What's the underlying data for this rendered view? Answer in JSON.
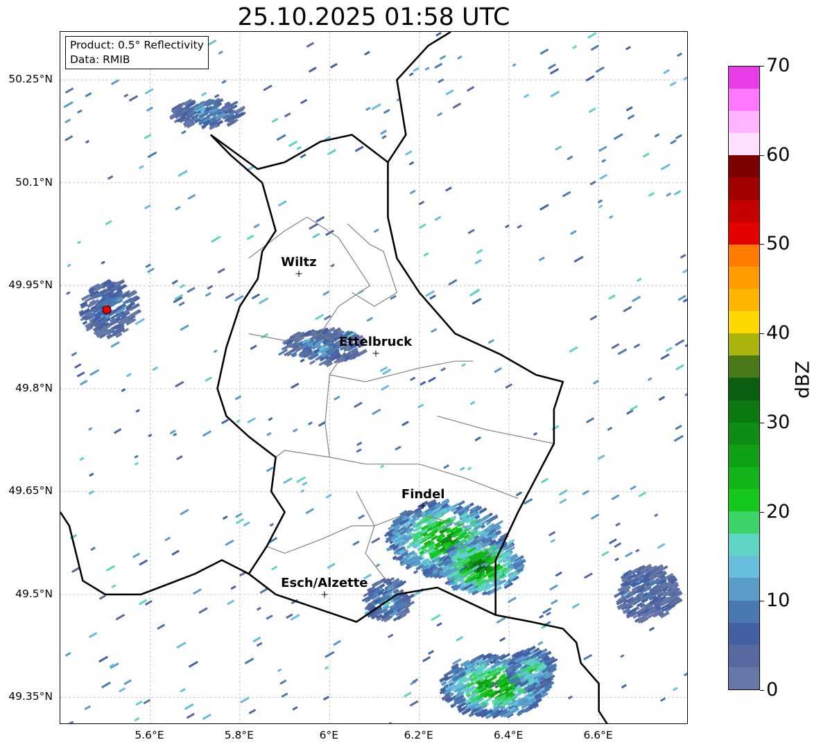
{
  "title": "25.10.2025 01:58 UTC",
  "info": {
    "product": "Product: 0.5° Reflectivity",
    "data": "Data: RMIB"
  },
  "extent": {
    "lon": [
      5.4,
      6.8
    ],
    "lat": [
      49.31,
      50.32
    ]
  },
  "lat_ticks": [
    {
      "value": 50.25,
      "label": "50.25°N"
    },
    {
      "value": 50.1,
      "label": "50.1°N"
    },
    {
      "value": 49.95,
      "label": "49.95°N"
    },
    {
      "value": 49.8,
      "label": "49.8°N"
    },
    {
      "value": 49.65,
      "label": "49.65°N"
    },
    {
      "value": 49.5,
      "label": "49.5°N"
    },
    {
      "value": 49.35,
      "label": "49.35°N"
    }
  ],
  "lon_ticks": [
    {
      "value": 5.6,
      "label": "5.6°E"
    },
    {
      "value": 5.8,
      "label": "5.8°E"
    },
    {
      "value": 6.0,
      "label": "6°E"
    },
    {
      "value": 6.2,
      "label": "6.2°E"
    },
    {
      "value": 6.4,
      "label": "6.4°E"
    },
    {
      "value": 6.6,
      "label": "6.6°E"
    }
  ],
  "cities": [
    {
      "name": "Wiltz",
      "lon": 5.933,
      "lat": 49.967
    },
    {
      "name": "Ettelbruck",
      "lon": 6.104,
      "lat": 49.85
    },
    {
      "name": "Findel",
      "lon": 6.21,
      "lat": 49.628
    },
    {
      "name": "Esch/Alzette",
      "lon": 5.99,
      "lat": 49.499
    }
  ],
  "radar_site": {
    "lon": 5.505,
    "lat": 49.914
  },
  "colorbar": {
    "label": "dBZ",
    "min": 0,
    "max": 70,
    "ticks": [
      {
        "value": 0,
        "label": "0"
      },
      {
        "value": 10,
        "label": "10"
      },
      {
        "value": 20,
        "label": "20"
      },
      {
        "value": 30,
        "label": "30"
      },
      {
        "value": 40,
        "label": "40"
      },
      {
        "value": 50,
        "label": "50"
      },
      {
        "value": 60,
        "label": "60"
      },
      {
        "value": 70,
        "label": "70"
      }
    ],
    "colors": [
      "#6678a8",
      "#5868a0",
      "#4460a4",
      "#4a78b0",
      "#5a9cc8",
      "#66bedc",
      "#5ed4c4",
      "#3cd468",
      "#14c81c",
      "#12b41a",
      "#10a016",
      "#0e8c14",
      "#0c7812",
      "#0a6010",
      "#4a7a18",
      "#aab40c",
      "#ffd800",
      "#ffb400",
      "#ff9c00",
      "#ff7c00",
      "#e40000",
      "#c40000",
      "#a00000",
      "#7c0000",
      "#ffe0ff",
      "#ffb4ff",
      "#ff78ff",
      "#e83ce8"
    ]
  },
  "borders": {
    "luxembourg": [
      [
        5.735,
        50.17
      ],
      [
        5.78,
        50.14
      ],
      [
        5.85,
        50.1
      ],
      [
        5.88,
        50.03
      ],
      [
        5.85,
        50.0
      ],
      [
        5.84,
        49.96
      ],
      [
        5.8,
        49.92
      ],
      [
        5.77,
        49.86
      ],
      [
        5.75,
        49.8
      ],
      [
        5.77,
        49.76
      ],
      [
        5.82,
        49.73
      ],
      [
        5.88,
        49.7
      ],
      [
        5.87,
        49.65
      ],
      [
        5.9,
        49.62
      ],
      [
        5.86,
        49.57
      ],
      [
        5.82,
        49.53
      ],
      [
        5.88,
        49.5
      ],
      [
        5.97,
        49.48
      ],
      [
        6.06,
        49.46
      ],
      [
        6.15,
        49.5
      ],
      [
        6.24,
        49.51
      ],
      [
        6.37,
        49.47
      ],
      [
        6.37,
        49.55
      ],
      [
        6.42,
        49.62
      ],
      [
        6.5,
        49.72
      ],
      [
        6.5,
        49.77
      ],
      [
        6.52,
        49.81
      ],
      [
        6.46,
        49.82
      ],
      [
        6.38,
        49.85
      ],
      [
        6.28,
        49.88
      ],
      [
        6.2,
        49.94
      ],
      [
        6.15,
        49.99
      ],
      [
        6.13,
        50.05
      ],
      [
        6.13,
        50.13
      ],
      [
        6.05,
        50.17
      ],
      [
        5.98,
        50.16
      ],
      [
        5.9,
        50.13
      ],
      [
        5.84,
        50.12
      ],
      [
        5.735,
        50.17
      ]
    ],
    "belgium_france": [
      [
        5.4,
        49.62
      ],
      [
        5.42,
        49.6
      ],
      [
        5.45,
        49.52
      ],
      [
        5.5,
        49.5
      ],
      [
        5.58,
        49.5
      ],
      [
        5.62,
        49.51
      ],
      [
        5.7,
        49.53
      ],
      [
        5.76,
        49.55
      ],
      [
        5.82,
        49.53
      ]
    ],
    "france_germany": [
      [
        6.37,
        49.47
      ],
      [
        6.45,
        49.46
      ],
      [
        6.52,
        49.45
      ],
      [
        6.55,
        49.43
      ],
      [
        6.56,
        49.4
      ],
      [
        6.6,
        49.37
      ],
      [
        6.6,
        49.33
      ],
      [
        6.62,
        49.31
      ]
    ],
    "germany_belgium": [
      [
        6.13,
        50.13
      ],
      [
        6.17,
        50.17
      ],
      [
        6.15,
        50.25
      ],
      [
        6.22,
        50.3
      ],
      [
        6.27,
        50.32
      ]
    ]
  },
  "cantons": [
    [
      [
        5.82,
        49.99
      ],
      [
        5.9,
        50.03
      ],
      [
        5.95,
        50.05
      ],
      [
        6.02,
        50.02
      ],
      [
        6.05,
        49.99
      ],
      [
        6.09,
        49.95
      ],
      [
        6.02,
        49.92
      ],
      [
        5.98,
        49.88
      ],
      [
        5.9,
        49.87
      ],
      [
        5.82,
        49.88
      ]
    ],
    [
      [
        6.04,
        50.04
      ],
      [
        6.09,
        50.01
      ],
      [
        6.12,
        50.0
      ],
      [
        6.15,
        49.94
      ],
      [
        6.1,
        49.92
      ],
      [
        6.05,
        49.94
      ]
    ],
    [
      [
        5.98,
        49.88
      ],
      [
        6.04,
        49.86
      ],
      [
        6.0,
        49.82
      ],
      [
        6.08,
        49.81
      ],
      [
        6.2,
        49.83
      ],
      [
        6.28,
        49.84
      ],
      [
        6.32,
        49.84
      ]
    ],
    [
      [
        6.0,
        49.82
      ],
      [
        5.99,
        49.75
      ],
      [
        6.0,
        49.7
      ],
      [
        6.08,
        49.69
      ],
      [
        6.2,
        49.69
      ],
      [
        6.3,
        49.67
      ],
      [
        6.42,
        49.64
      ]
    ],
    [
      [
        6.24,
        49.76
      ],
      [
        6.35,
        49.74
      ],
      [
        6.5,
        49.72
      ]
    ],
    [
      [
        5.88,
        49.7
      ],
      [
        5.9,
        49.71
      ],
      [
        6.0,
        49.7
      ]
    ],
    [
      [
        5.86,
        49.57
      ],
      [
        5.9,
        49.56
      ],
      [
        5.98,
        49.58
      ],
      [
        6.05,
        49.6
      ],
      [
        6.1,
        49.6
      ],
      [
        6.18,
        49.62
      ],
      [
        6.3,
        49.6
      ],
      [
        6.37,
        49.55
      ]
    ],
    [
      [
        6.06,
        49.65
      ],
      [
        6.1,
        49.6
      ],
      [
        6.08,
        49.56
      ],
      [
        6.15,
        49.5
      ]
    ]
  ],
  "precip_cells": [
    {
      "lon": 6.25,
      "lat": 49.58,
      "rx": 0.13,
      "ry": 0.055,
      "level": 28
    },
    {
      "lon": 6.33,
      "lat": 49.54,
      "rx": 0.09,
      "ry": 0.04,
      "level": 32
    },
    {
      "lon": 6.36,
      "lat": 49.365,
      "rx": 0.12,
      "ry": 0.045,
      "level": 28
    },
    {
      "lon": 6.44,
      "lat": 49.39,
      "rx": 0.05,
      "ry": 0.03,
      "level": 22
    },
    {
      "lon": 6.12,
      "lat": 49.49,
      "rx": 0.05,
      "ry": 0.03,
      "level": 14
    },
    {
      "lon": 5.5,
      "lat": 49.914,
      "rx": 0.06,
      "ry": 0.04,
      "level": 10
    },
    {
      "lon": 5.72,
      "lat": 50.2,
      "rx": 0.08,
      "ry": 0.02,
      "level": 12
    },
    {
      "lon": 5.98,
      "lat": 49.86,
      "rx": 0.09,
      "ry": 0.025,
      "level": 11
    },
    {
      "lon": 6.7,
      "lat": 49.5,
      "rx": 0.07,
      "ry": 0.04,
      "level": 7
    }
  ]
}
